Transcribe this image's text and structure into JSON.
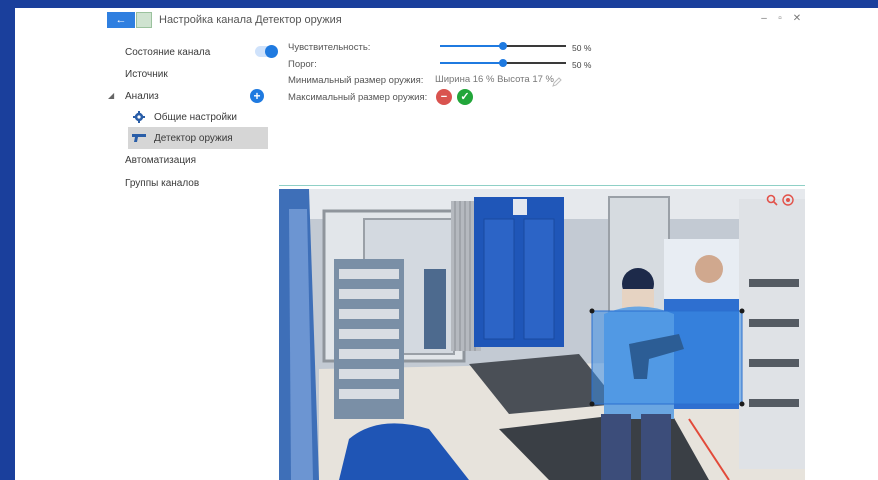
{
  "titlebar": {
    "back_icon": "arrow-left-icon",
    "title": "Настройка канала Детектор оружия",
    "minimize": "–",
    "maximize": "▫",
    "close": "✕"
  },
  "sidebar": {
    "channel_state": "Состояние канала",
    "channel_state_on": true,
    "source": "Источник",
    "analysis": "Анализ",
    "general_settings": "Общие настройки",
    "weapon_detector": "Детектор оружия",
    "automation": "Автоматизация",
    "channel_groups": "Группы каналов"
  },
  "settings": {
    "sensitivity_label": "Чувствительность:",
    "sensitivity_value": "50 %",
    "sensitivity_fraction": 0.5,
    "threshold_label": "Порог:",
    "threshold_value": "50 %",
    "threshold_fraction": 0.5,
    "min_size_label": "Минимальный размер оружия:",
    "min_size_text": "Ширина  16 % Высота  17 %",
    "max_size_label": "Максимальный размер оружия:"
  },
  "colors": {
    "accent": "#1f7ae0",
    "frame": "#1a3f9c",
    "red_button": "#d9534f",
    "green_button": "#22a63a",
    "detection_box": "#3d8ee6"
  }
}
